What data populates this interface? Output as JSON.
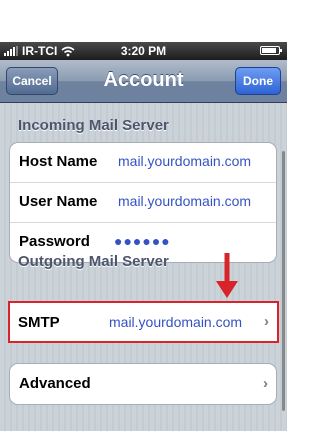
{
  "status_bar": {
    "carrier": "IR-TCI",
    "time": "3:20 PM",
    "battery_level": 0.85
  },
  "nav": {
    "title": "Account",
    "cancel_label": "Cancel",
    "done_label": "Done"
  },
  "incoming": {
    "header": "Incoming Mail Server",
    "rows": [
      {
        "label": "Host Name",
        "value": "mail.yourdomain.com"
      },
      {
        "label": "User Name",
        "value": "mail.yourdomain.com"
      },
      {
        "label": "Password",
        "value": "●●●●●●"
      }
    ]
  },
  "outgoing": {
    "header": "Outgoing Mail Server",
    "smtp_label": "SMTP",
    "smtp_value": "mail.yourdomain.com"
  },
  "advanced_label": "Advanced",
  "colors": {
    "highlight_red": "#d8232a",
    "value_blue": "#3552c5"
  }
}
